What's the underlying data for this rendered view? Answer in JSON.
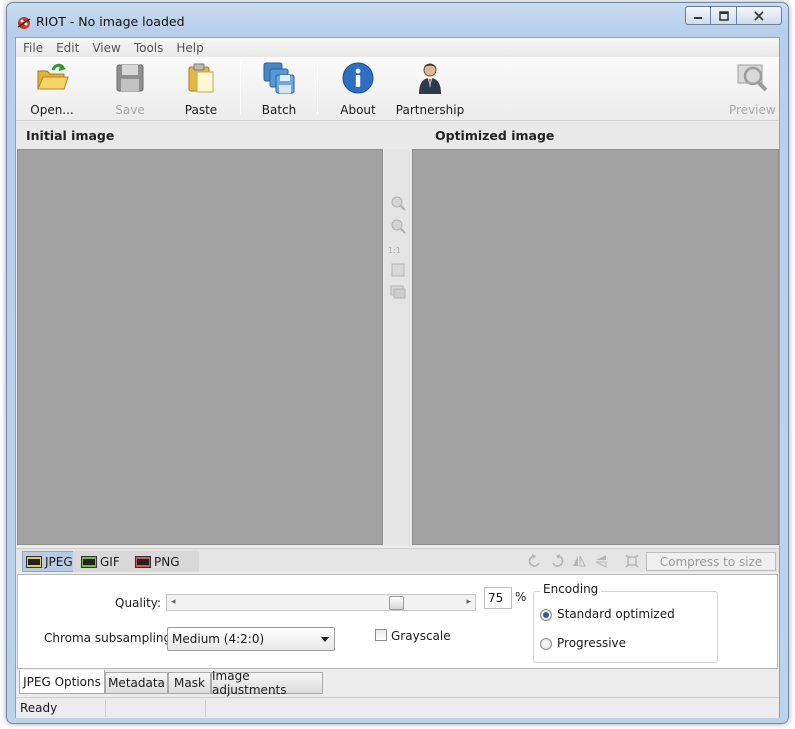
{
  "window": {
    "title": "RIOT - No image loaded"
  },
  "menu": [
    "File",
    "Edit",
    "View",
    "Tools",
    "Help"
  ],
  "toolbar": {
    "open": "Open...",
    "save": "Save",
    "paste": "Paste",
    "batch": "Batch",
    "about": "About",
    "partnership": "Partnership",
    "preview": "Preview"
  },
  "panes": {
    "initial_title": "Initial image",
    "optimized_title": "Optimized image",
    "zoom_one_to_one": "1:1"
  },
  "formats": {
    "tabs": [
      "JPEG",
      "GIF",
      "PNG"
    ],
    "active": "JPEG",
    "compress_button": "Compress to size"
  },
  "options": {
    "quality_label": "Quality:",
    "quality_value": "75",
    "quality_fraction": 0.75,
    "percent_sign": "%",
    "chroma_label": "Chroma subsampling:",
    "chroma_value": "Medium (4:2:0)",
    "grayscale_label": "Grayscale",
    "grayscale_checked": false,
    "encoding_title": "Encoding",
    "encoding_standard": "Standard optimized",
    "encoding_progressive": "Progressive",
    "encoding_selected": "Standard optimized"
  },
  "bottom_tabs": [
    "JPEG Options",
    "Metadata",
    "Mask",
    "Image adjustments"
  ],
  "status": {
    "text": "Ready"
  },
  "colors": {
    "canvas": "#a2a2a2",
    "title_bar": "#c9dcf1",
    "active_format_tab": "#b8cbe2",
    "radio_dot": "#2f5d99"
  }
}
